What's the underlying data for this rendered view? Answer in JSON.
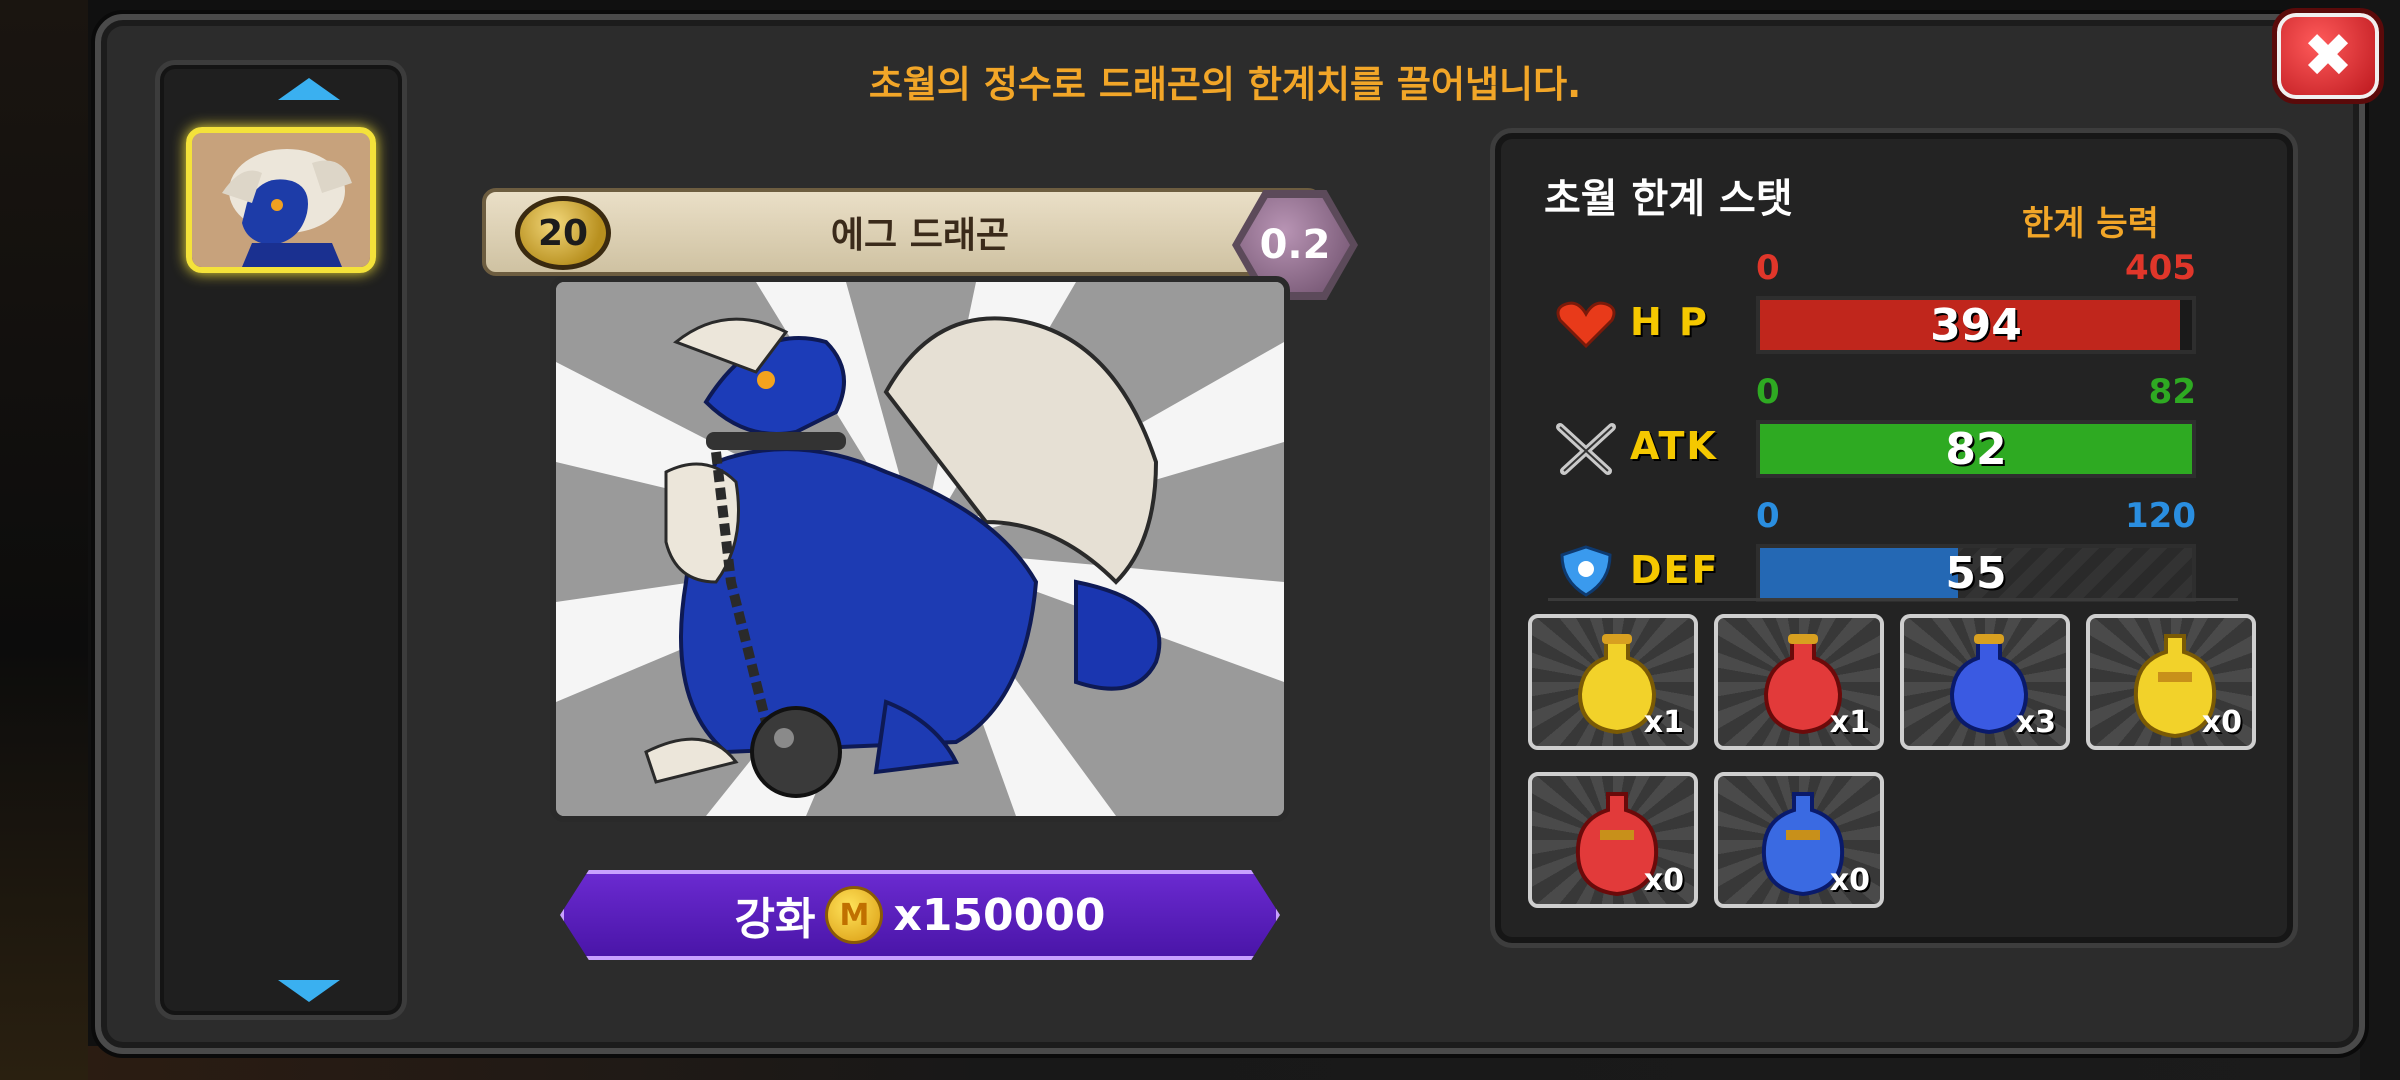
{
  "headline": "초월의 정수로 드래곤의 한계치를 끌어냅니다.",
  "dragon": {
    "level": "20",
    "name": "에그 드래곤",
    "grade": "0.2"
  },
  "upgrade": {
    "label": "강화",
    "coin_symbol": "M",
    "cost": "x150000"
  },
  "stats": {
    "title": "초월 한계 스탯",
    "limit_label": "한계 능력",
    "hp": {
      "label": "H P",
      "min": "0",
      "max": "405",
      "value": "394",
      "fraction": 0.973,
      "color": "#c0261c",
      "range_color": "#e0362a"
    },
    "atk": {
      "label": "ATK",
      "min": "0",
      "max": "82",
      "value": "82",
      "fraction": 1.0,
      "color": "#2eaa22",
      "range_color": "#2eaa22"
    },
    "def": {
      "label": "DEF",
      "min": "0",
      "max": "120",
      "value": "55",
      "fraction": 0.458,
      "color": "#2468b4",
      "range_color": "#2a8ee0"
    }
  },
  "potions": [
    {
      "color": "gold",
      "count": "x1"
    },
    {
      "color": "red",
      "count": "x1"
    },
    {
      "color": "blue",
      "count": "x3"
    },
    {
      "color": "gold-large",
      "count": "x0"
    },
    {
      "color": "red-large",
      "count": "x0"
    },
    {
      "color": "blue-large",
      "count": "x0"
    }
  ],
  "icons": {
    "close": "close-icon",
    "scroll_up": "chevron-up-icon",
    "scroll_down": "chevron-down-icon",
    "hp": "heart-icon",
    "atk": "crossed-swords-icon",
    "def": "shield-icon",
    "coin": "coin-icon"
  }
}
